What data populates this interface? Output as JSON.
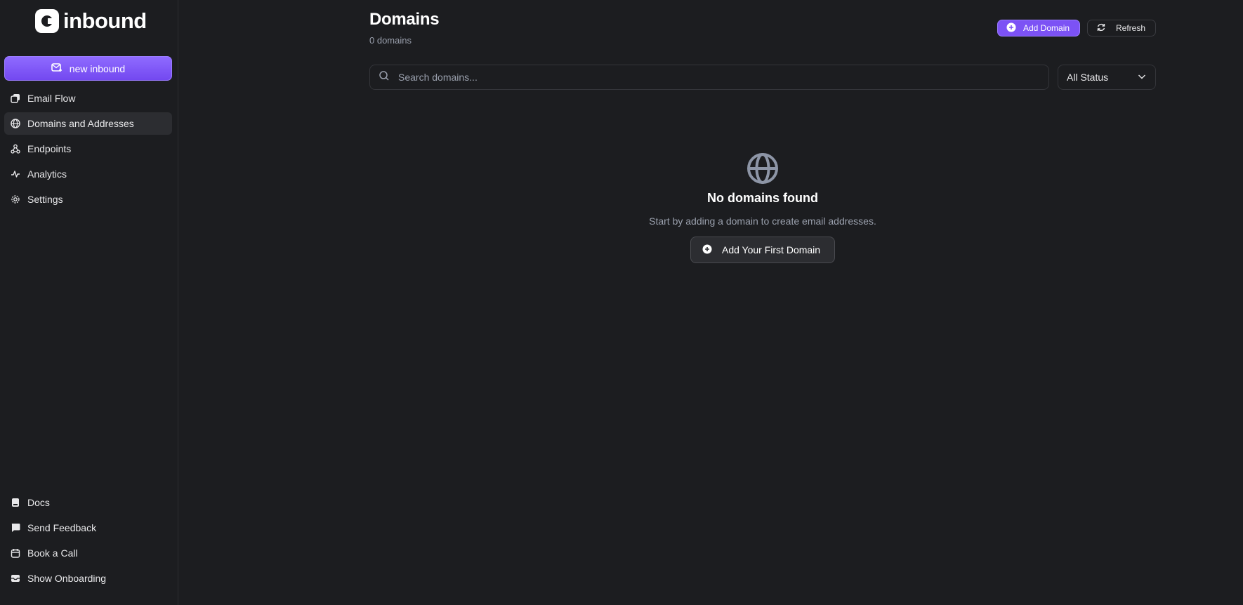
{
  "brand": {
    "name": "inbound"
  },
  "sidebar": {
    "new_button": "new inbound",
    "items": [
      {
        "label": "Email Flow",
        "icon": "email-flow-icon",
        "active": false
      },
      {
        "label": "Domains and Addresses",
        "icon": "globe-icon",
        "active": true
      },
      {
        "label": "Endpoints",
        "icon": "webhook-icon",
        "active": false
      },
      {
        "label": "Analytics",
        "icon": "activity-icon",
        "active": false
      },
      {
        "label": "Settings",
        "icon": "gear-icon",
        "active": false
      }
    ],
    "bottom_items": [
      {
        "label": "Docs",
        "icon": "book-icon"
      },
      {
        "label": "Send Feedback",
        "icon": "chat-bubble-icon"
      },
      {
        "label": "Book a Call",
        "icon": "calendar-icon"
      },
      {
        "label": "Show Onboarding",
        "icon": "inbox-icon"
      }
    ]
  },
  "header": {
    "title": "Domains",
    "subtitle": "0 domains",
    "add_button": "Add Domain",
    "refresh_button": "Refresh"
  },
  "filters": {
    "search_placeholder": "Search domains...",
    "search_value": "",
    "status_selected": "All Status"
  },
  "empty_state": {
    "icon": "globe-icon",
    "title": "No domains found",
    "text": "Start by adding a domain to create email addresses.",
    "button": "Add Your First Domain"
  },
  "colors": {
    "background": "#1c1d20",
    "accent": "#7c52f5",
    "muted_text": "#9aa0ad"
  }
}
